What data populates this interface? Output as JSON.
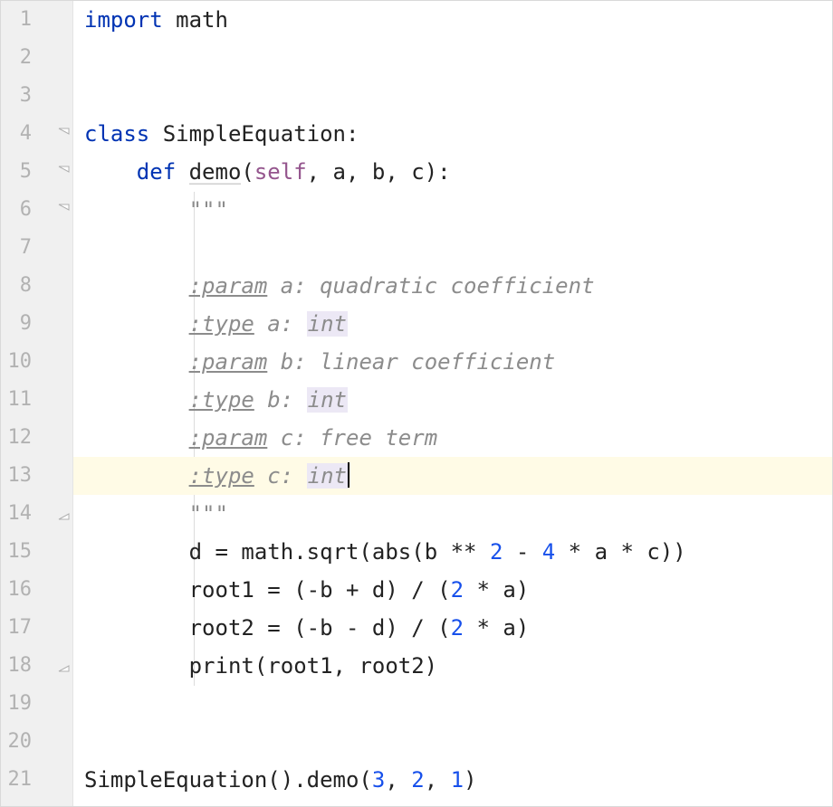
{
  "line_numbers": [
    "1",
    "2",
    "3",
    "4",
    "5",
    "6",
    "7",
    "8",
    "9",
    "10",
    "11",
    "12",
    "13",
    "14",
    "15",
    "16",
    "17",
    "18",
    "19",
    "20",
    "21"
  ],
  "code": {
    "l1": {
      "kw": "import",
      "rest": " math"
    },
    "l4": {
      "kw": "class",
      "name": " SimpleEquation:"
    },
    "l5": {
      "kw": "def",
      "name": " ",
      "fn": "demo",
      "params_open": "(",
      "self": "self",
      "params_rest": ", a, b, c):"
    },
    "l6": {
      "doc": "\"\"\""
    },
    "l8": {
      "tag": ":param",
      "after": " a: quadratic coefficient"
    },
    "l9": {
      "tag": ":type",
      "after": " a: ",
      "type": "int"
    },
    "l10": {
      "tag": ":param",
      "after": " b: linear coefficient"
    },
    "l11": {
      "tag": ":type",
      "after": " b: ",
      "type": "int"
    },
    "l12": {
      "tag": ":param",
      "after": " c: free term"
    },
    "l13": {
      "tag": ":type",
      "after": " c: ",
      "type": "int"
    },
    "l14": {
      "doc": "\"\"\""
    },
    "l15_a": "d = math.sqrt(",
    "l15_abs": "abs",
    "l15_b": "(b ** ",
    "l15_n1": "2",
    "l15_c": " - ",
    "l15_n2": "4",
    "l15_d": " * a * c))",
    "l16_a": "root1 = (-b + d) / (",
    "l16_n": "2",
    "l16_b": " * a)",
    "l17_a": "root2 = (-b - d) / (",
    "l17_n": "2",
    "l17_b": " * a)",
    "l18_p": "print",
    "l18_a": "(root1, root2)",
    "l21_a": "SimpleEquation().demo(",
    "l21_n1": "3",
    "l21_c1": ", ",
    "l21_n2": "2",
    "l21_c2": ", ",
    "l21_n3": "1",
    "l21_b": ")"
  }
}
